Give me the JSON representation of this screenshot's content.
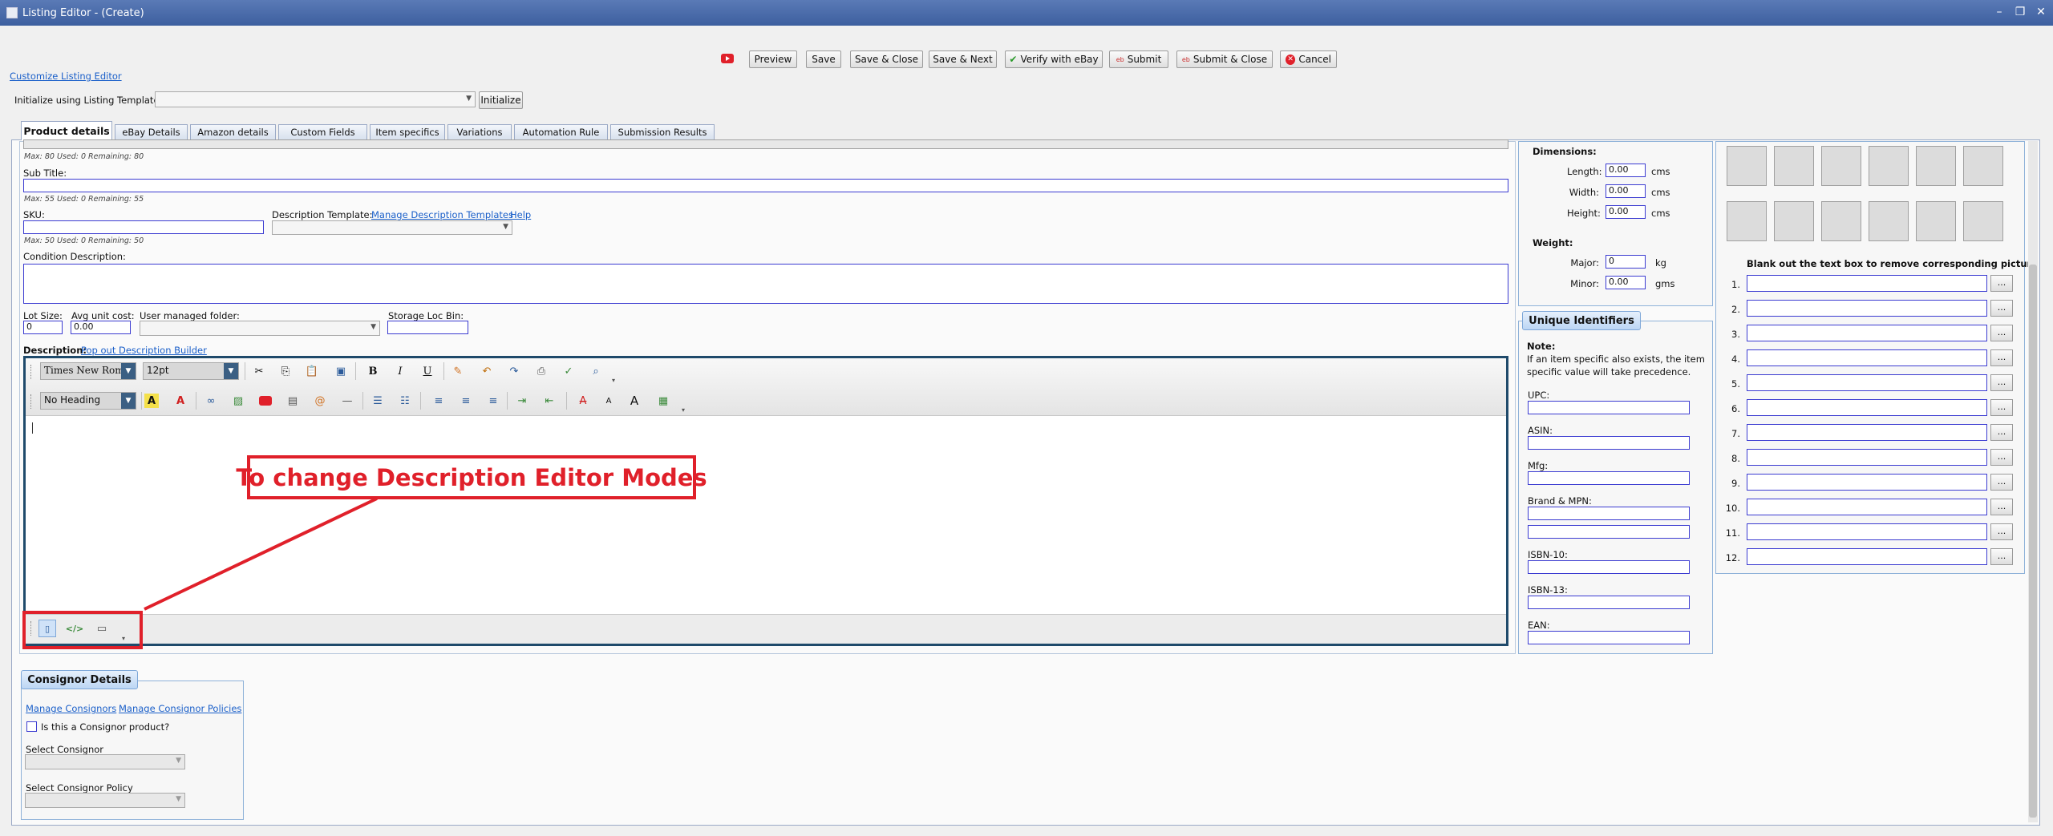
{
  "window": {
    "title": "Listing Editor - (Create)"
  },
  "toolbar": {
    "preview": "Preview",
    "save": "Save",
    "save_close": "Save & Close",
    "save_next": "Save & Next",
    "verify": "Verify with eBay",
    "submit": "Submit",
    "submit_close": "Submit & Close",
    "cancel": "Cancel"
  },
  "customize_link": "Customize Listing Editor",
  "init": {
    "label": "Initialize using Listing Template:",
    "button": "Initialize",
    "value": ""
  },
  "tabs": [
    "Product details",
    "eBay Details",
    "Amazon details",
    "Custom Fields",
    "Item specifics",
    "Variations",
    "Automation Rule",
    "Submission Results"
  ],
  "product": {
    "title_counter": "Max: 80 Used: 0 Remaining: 80",
    "subtitle_label": "Sub Title:",
    "subtitle_counter": "Max: 55 Used: 0 Remaining: 55",
    "sku_label": "SKU:",
    "sku_counter": "Max: 50 Used: 0 Remaining: 50",
    "desc_template_label": "Description Template:",
    "manage_templates": "Manage Description Templates",
    "help": "Help",
    "condition_label": "Condition Description:",
    "lot_size_label": "Lot Size:",
    "lot_size_value": "0",
    "avg_cost_label": "Avg unit cost:",
    "avg_cost_value": "0.00",
    "folder_label": "User managed folder:",
    "storage_label": "Storage Loc Bin:",
    "description_label": "Description:",
    "popout_link": "Pop out Description Builder"
  },
  "editor": {
    "font": "Times New Roman",
    "size": "12pt",
    "heading": "No Heading",
    "callout": "To change Description Editor Modes",
    "accent": "#e0202a"
  },
  "dimensions": {
    "title": "Dimensions:",
    "length_label": "Length:",
    "length": "0.00",
    "width_label": "Width:",
    "width": "0.00",
    "height_label": "Height:",
    "height": "0.00",
    "unit": "cms",
    "weight_title": "Weight:",
    "major_label": "Major:",
    "major": "0",
    "major_unit": "kg",
    "minor_label": "Minor:",
    "minor": "0.00",
    "minor_unit": "gms"
  },
  "identifiers": {
    "header": "Unique Identifiers",
    "note_title": "Note:",
    "note_line1": "If an item specific also exists, the item",
    "note_line2": "specific value will take precedence.",
    "upc": "UPC:",
    "asin": "ASIN:",
    "mfg": "Mfg:",
    "brand": "Brand & MPN:",
    "isbn10": "ISBN-10:",
    "isbn13": "ISBN-13:",
    "ean": "EAN:"
  },
  "pictures": {
    "hint": "Blank out the text box to remove corresponding picture",
    "numbers": [
      "1.",
      "2.",
      "3.",
      "4.",
      "5.",
      "6.",
      "7.",
      "8.",
      "9.",
      "10.",
      "11.",
      "12."
    ],
    "browse": "..."
  },
  "consignor": {
    "header": "Consignor Details",
    "manage": "Manage Consignors",
    "policies": "Manage Consignor Policies",
    "checkbox": "Is this a Consignor product?",
    "select_label": "Select Consignor",
    "policy_label": "Select Consignor Policy"
  }
}
